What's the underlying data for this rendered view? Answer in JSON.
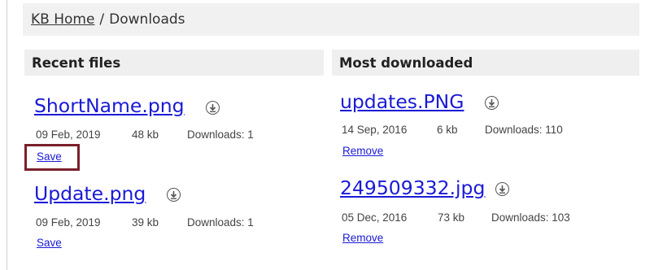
{
  "breadcrumb": {
    "home": "KB Home",
    "separator": "/",
    "current": "Downloads"
  },
  "recent": {
    "header": "Recent files",
    "items": [
      {
        "name": "ShortName.png",
        "date": "09 Feb, 2019",
        "size": "48 kb",
        "downloads": "Downloads: 1",
        "action": "Save"
      },
      {
        "name": "Update.png",
        "date": "09 Feb, 2019",
        "size": "39 kb",
        "downloads": "Downloads: 1",
        "action": "Save"
      }
    ]
  },
  "most_downloaded": {
    "header": "Most downloaded",
    "items": [
      {
        "name": "updates.PNG",
        "date": "14 Sep, 2016",
        "size": "6 kb",
        "downloads": "Downloads: 110",
        "action": "Remove"
      },
      {
        "name": "249509332.jpg",
        "date": "05 Dec, 2016",
        "size": "73 kb",
        "downloads": "Downloads: 103",
        "action": "Remove"
      }
    ]
  },
  "icons": {
    "download": "download-circle-icon"
  },
  "colors": {
    "link": "#1a1ad6",
    "highlight": "#7a1f2b",
    "header_bg": "#efefef"
  }
}
